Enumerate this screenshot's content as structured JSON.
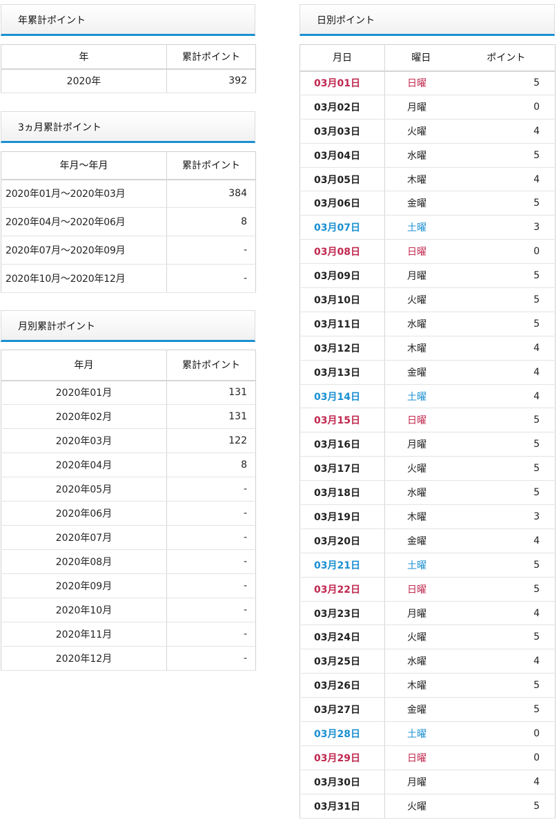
{
  "yearly": {
    "title": "年累計ポイント",
    "headers": [
      "年",
      "累計ポイント"
    ],
    "rows": [
      [
        "2020年",
        "392"
      ]
    ]
  },
  "quarterly": {
    "title": "3ヵ月累計ポイント",
    "headers": [
      "年月～年月",
      "累計ポイント"
    ],
    "rows": [
      [
        "2020年01月～2020年03月",
        "384"
      ],
      [
        "2020年04月～2020年06月",
        "8"
      ],
      [
        "2020年07月～2020年09月",
        "-"
      ],
      [
        "2020年10月～2020年12月",
        "-"
      ]
    ]
  },
  "monthly": {
    "title": "月別累計ポイント",
    "headers": [
      "年月",
      "累計ポイント"
    ],
    "rows": [
      [
        "2020年01月",
        "131"
      ],
      [
        "2020年02月",
        "131"
      ],
      [
        "2020年03月",
        "122"
      ],
      [
        "2020年04月",
        "8"
      ],
      [
        "2020年05月",
        "-"
      ],
      [
        "2020年06月",
        "-"
      ],
      [
        "2020年07月",
        "-"
      ],
      [
        "2020年08月",
        "-"
      ],
      [
        "2020年09月",
        "-"
      ],
      [
        "2020年10月",
        "-"
      ],
      [
        "2020年11月",
        "-"
      ],
      [
        "2020年12月",
        "-"
      ]
    ]
  },
  "daily": {
    "title": "日別ポイント",
    "headers": [
      "月日",
      "曜日",
      "ポイント"
    ],
    "colors": {
      "sunday": "#c0284e",
      "saturday": "#1a8fd1"
    },
    "rows": [
      [
        "03月01日",
        "日曜",
        "5"
      ],
      [
        "03月02日",
        "月曜",
        "0"
      ],
      [
        "03月03日",
        "火曜",
        "4"
      ],
      [
        "03月04日",
        "水曜",
        "5"
      ],
      [
        "03月05日",
        "木曜",
        "4"
      ],
      [
        "03月06日",
        "金曜",
        "5"
      ],
      [
        "03月07日",
        "土曜",
        "3"
      ],
      [
        "03月08日",
        "日曜",
        "0"
      ],
      [
        "03月09日",
        "月曜",
        "5"
      ],
      [
        "03月10日",
        "火曜",
        "5"
      ],
      [
        "03月11日",
        "水曜",
        "5"
      ],
      [
        "03月12日",
        "木曜",
        "4"
      ],
      [
        "03月13日",
        "金曜",
        "4"
      ],
      [
        "03月14日",
        "土曜",
        "4"
      ],
      [
        "03月15日",
        "日曜",
        "5"
      ],
      [
        "03月16日",
        "月曜",
        "5"
      ],
      [
        "03月17日",
        "火曜",
        "5"
      ],
      [
        "03月18日",
        "水曜",
        "5"
      ],
      [
        "03月19日",
        "木曜",
        "3"
      ],
      [
        "03月20日",
        "金曜",
        "4"
      ],
      [
        "03月21日",
        "土曜",
        "5"
      ],
      [
        "03月22日",
        "日曜",
        "5"
      ],
      [
        "03月23日",
        "月曜",
        "4"
      ],
      [
        "03月24日",
        "火曜",
        "5"
      ],
      [
        "03月25日",
        "水曜",
        "4"
      ],
      [
        "03月26日",
        "木曜",
        "5"
      ],
      [
        "03月27日",
        "金曜",
        "5"
      ],
      [
        "03月28日",
        "土曜",
        "0"
      ],
      [
        "03月29日",
        "日曜",
        "0"
      ],
      [
        "03月30日",
        "月曜",
        "4"
      ],
      [
        "03月31日",
        "火曜",
        "5"
      ]
    ]
  }
}
